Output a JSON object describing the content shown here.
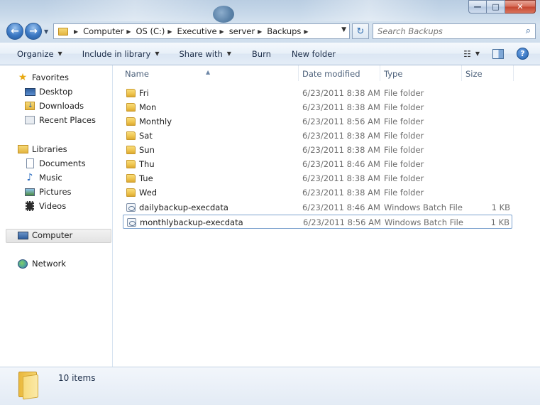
{
  "window": {
    "minimize": "—",
    "maximize": "□",
    "close": "✕"
  },
  "nav": {
    "back_icon": "back-arrow-icon",
    "forward_icon": "forward-arrow-icon"
  },
  "address": {
    "crumbs": [
      "Computer",
      "OS (C:)",
      "Executive",
      "server",
      "Backups"
    ]
  },
  "search": {
    "placeholder": "Search Backups"
  },
  "toolbar": {
    "organize": "Organize",
    "include_in_library": "Include in library",
    "share_with": "Share with",
    "burn": "Burn",
    "new_folder": "New folder"
  },
  "sidebar": {
    "favorites": "Favorites",
    "desktop": "Desktop",
    "downloads": "Downloads",
    "recent_places": "Recent Places",
    "libraries": "Libraries",
    "documents": "Documents",
    "music": "Music",
    "pictures": "Pictures",
    "videos": "Videos",
    "computer": "Computer",
    "network": "Network"
  },
  "columns": {
    "name": "Name",
    "date_modified": "Date modified",
    "type": "Type",
    "size": "Size"
  },
  "files": [
    {
      "name": "Fri",
      "date": "6/23/2011 8:38 AM",
      "type": "File folder",
      "size": "",
      "icon": "folder-icon"
    },
    {
      "name": "Mon",
      "date": "6/23/2011 8:38 AM",
      "type": "File folder",
      "size": "",
      "icon": "folder-icon"
    },
    {
      "name": "Monthly",
      "date": "6/23/2011 8:56 AM",
      "type": "File folder",
      "size": "",
      "icon": "folder-icon"
    },
    {
      "name": "Sat",
      "date": "6/23/2011 8:38 AM",
      "type": "File folder",
      "size": "",
      "icon": "folder-icon"
    },
    {
      "name": "Sun",
      "date": "6/23/2011 8:38 AM",
      "type": "File folder",
      "size": "",
      "icon": "folder-icon"
    },
    {
      "name": "Thu",
      "date": "6/23/2011 8:46 AM",
      "type": "File folder",
      "size": "",
      "icon": "folder-icon"
    },
    {
      "name": "Tue",
      "date": "6/23/2011 8:38 AM",
      "type": "File folder",
      "size": "",
      "icon": "folder-icon"
    },
    {
      "name": "Wed",
      "date": "6/23/2011 8:38 AM",
      "type": "File folder",
      "size": "",
      "icon": "folder-icon"
    },
    {
      "name": "dailybackup-execdata",
      "date": "6/23/2011 8:46 AM",
      "type": "Windows Batch File",
      "size": "1 KB",
      "icon": "batch-file-icon"
    },
    {
      "name": "monthlybackup-execdata",
      "date": "6/23/2011 8:56 AM",
      "type": "Windows Batch File",
      "size": "1 KB",
      "icon": "batch-file-icon"
    }
  ],
  "status": {
    "count": "10 items"
  }
}
